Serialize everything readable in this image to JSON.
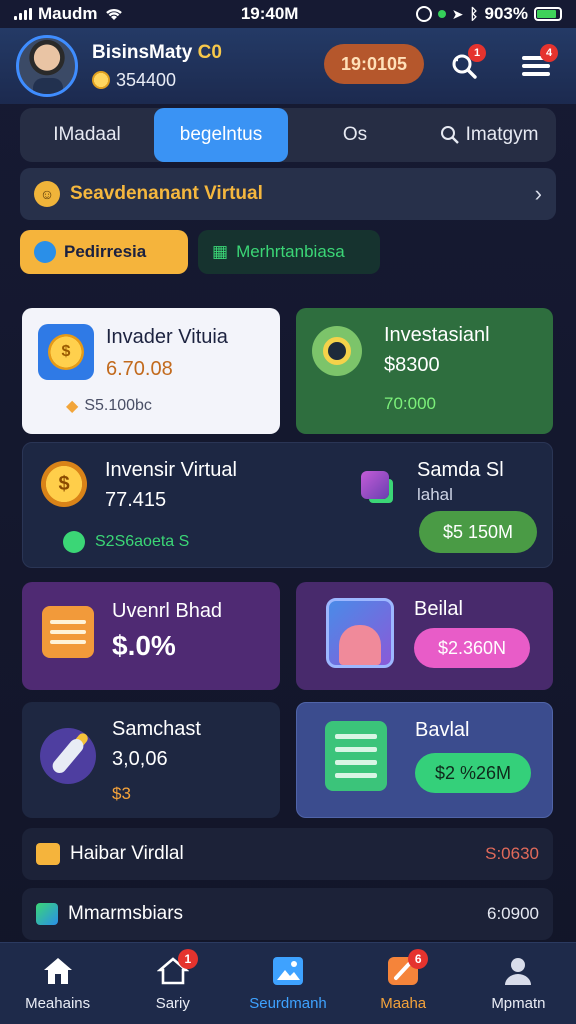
{
  "status": {
    "carrier": "Maudm",
    "time": "19:40M",
    "battery": "903%"
  },
  "header": {
    "name": "BisinsMaty",
    "name_highlight": "C0",
    "balance": "354400",
    "coins_pill": "19:0105",
    "search_badge": "1",
    "menu_badge": "4"
  },
  "tabs": [
    {
      "label": "IMadaal"
    },
    {
      "label": "begelntus"
    },
    {
      "label": "Os"
    },
    {
      "label": "Imatgym"
    }
  ],
  "banner": {
    "text": "Seavdenanant Virtual"
  },
  "chips": {
    "primary": "Pedirresia",
    "secondary": "Merhrtanbiasa"
  },
  "cards": {
    "c1": {
      "title": "Invader Vituia",
      "value": "6.70.08",
      "sub": "S5.100bc"
    },
    "c2": {
      "title": "Investasianl",
      "value": "$8300",
      "sub": "70:000"
    },
    "c3": {
      "title": "Invensir Virtual",
      "value": "77.415",
      "sub": "S2S6aoeta S",
      "right_title": "Samda Sl",
      "right_sub": "lahal",
      "button": "$5 150M"
    },
    "c4": {
      "title": "Uvenrl Bhad",
      "value": "$.0%"
    },
    "c5": {
      "title": "Beilal",
      "button": "$2.360N"
    },
    "c6": {
      "title": "Samchast",
      "value": "3,0,06",
      "sub": "$3"
    },
    "c7": {
      "title": "Bavlal",
      "button": "$2 %26M"
    }
  },
  "rows": [
    {
      "label": "Haibar Virdlal",
      "value": "S:0630"
    },
    {
      "label": "Mmarmsbiars",
      "value": "6:0900"
    }
  ],
  "nav": [
    {
      "label": "Meahains"
    },
    {
      "label": "Sariy",
      "badge": "1"
    },
    {
      "label": "Seurdmanh"
    },
    {
      "label": "Maaha",
      "badge": "6"
    },
    {
      "label": "Mpmatn"
    }
  ],
  "colors": {
    "accent": "#3a93f4",
    "gold": "#f5b43c",
    "green": "#3bd676",
    "pink": "#e85cc8"
  }
}
